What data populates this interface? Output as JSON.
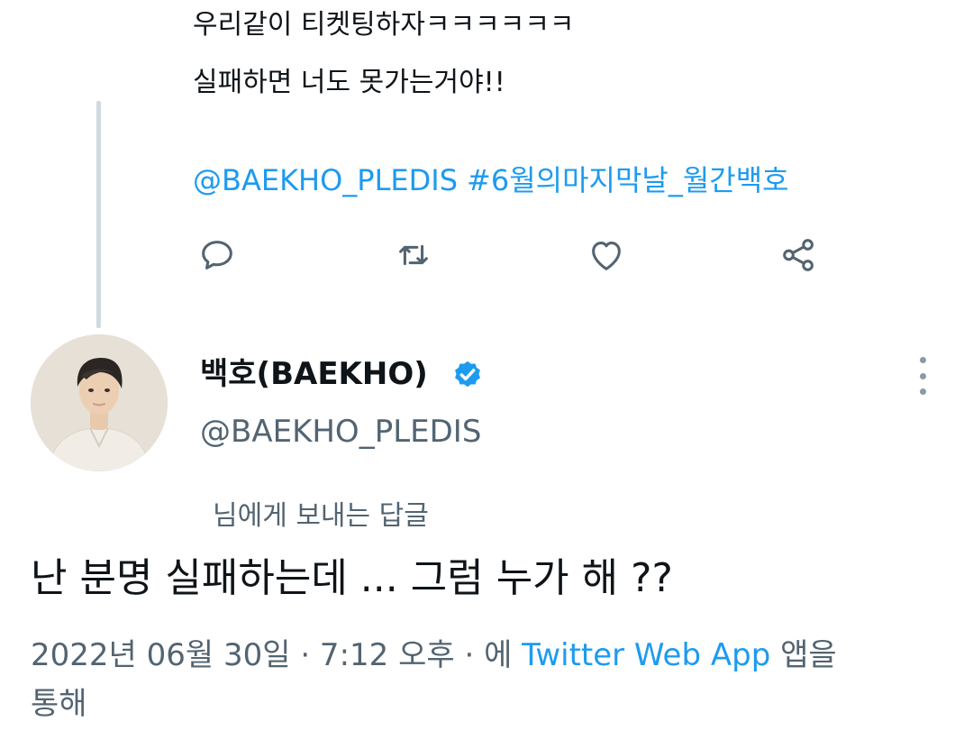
{
  "previous_tweet": {
    "line1": "우리같이 티켓팅하자ㅋㅋㅋㅋㅋㅋ",
    "line2": "실패하면 너도 못가는거야!!",
    "mention": "@BAEKHO_PLEDIS",
    "hashtag": "#6월의마지막날_월간백호"
  },
  "actions": {
    "reply_icon": "reply-icon",
    "retweet_icon": "retweet-icon",
    "like_icon": "heart-icon",
    "share_icon": "share-icon"
  },
  "author": {
    "display_name": "백호(BAEKHO)",
    "handle": "@BAEKHO_PLEDIS",
    "verified": true
  },
  "tweet": {
    "reply_to": "님에게 보내는 답글",
    "text": "난 분명 실패하는데 ... 그럼 누가 해 ??",
    "timestamp": "2022년 06월 30일 · 7:12 오후 · 에",
    "app_name": "Twitter Web App",
    "app_suffix": "앱을",
    "app_suffix2": "통해"
  },
  "colors": {
    "link": "#1d9bf0",
    "secondary_text": "#536471",
    "primary_text": "#0f1419",
    "thread_line": "#cfd9de"
  }
}
